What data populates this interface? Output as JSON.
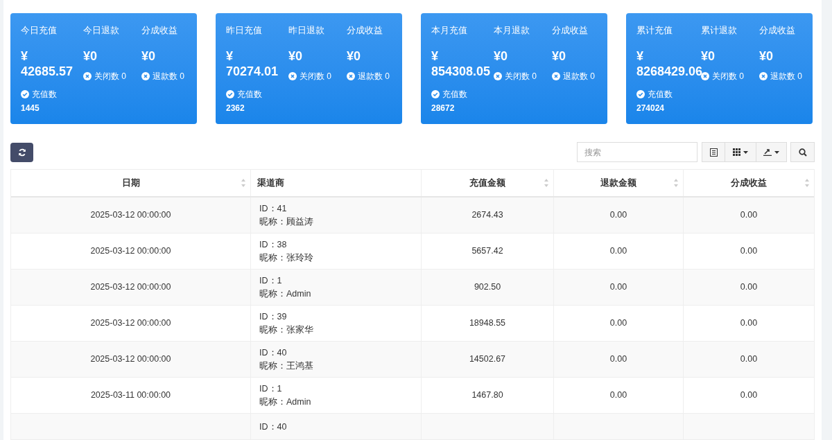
{
  "cards": [
    {
      "columns": [
        {
          "label": "今日充值",
          "value": "¥ 42685.57",
          "kind": "check",
          "stat_label": "充值数",
          "stat_value": "1445"
        },
        {
          "label": "今日退款",
          "value": "¥0",
          "kind": "cross",
          "stat_label": "关闭数 0"
        },
        {
          "label": "分成收益",
          "value": "¥0",
          "kind": "cross",
          "stat_label": "退款数 0"
        }
      ]
    },
    {
      "columns": [
        {
          "label": "昨日充值",
          "value": "¥ 70274.01",
          "kind": "check",
          "stat_label": "充值数",
          "stat_value": "2362"
        },
        {
          "label": "昨日退款",
          "value": "¥0",
          "kind": "cross",
          "stat_label": "关闭数 0"
        },
        {
          "label": "分成收益",
          "value": "¥0",
          "kind": "cross",
          "stat_label": "退款数 0"
        }
      ]
    },
    {
      "columns": [
        {
          "label": "本月充值",
          "value": "¥ 854308.05",
          "kind": "check",
          "stat_label": "充值数",
          "stat_value": "28672"
        },
        {
          "label": "本月退款",
          "value": "¥0",
          "kind": "cross",
          "stat_label": "关闭数 0"
        },
        {
          "label": "分成收益",
          "value": "¥0",
          "kind": "cross",
          "stat_label": "退款数 0"
        }
      ]
    },
    {
      "columns": [
        {
          "label": "累计充值",
          "value": "¥ 8268429.06",
          "kind": "check",
          "stat_label": "充值数",
          "stat_value": "274024"
        },
        {
          "label": "累计退款",
          "value": "¥0",
          "kind": "cross",
          "stat_label": "关闭数 0"
        },
        {
          "label": "分成收益",
          "value": "¥0",
          "kind": "cross",
          "stat_label": "退款数 0"
        }
      ]
    }
  ],
  "search": {
    "placeholder": "搜索"
  },
  "table": {
    "columns": [
      {
        "label": "日期",
        "sortable": true
      },
      {
        "label": "渠道商",
        "sortable": false
      },
      {
        "label": "充值金额",
        "sortable": true
      },
      {
        "label": "退款金额",
        "sortable": true
      },
      {
        "label": "分成收益",
        "sortable": true
      }
    ],
    "rows": [
      {
        "date": "2025-03-12 00:00:00",
        "channel_id": "ID：41",
        "channel_name": "昵称：顾益涛",
        "recharge": "2674.43",
        "refund": "0.00",
        "share": "0.00"
      },
      {
        "date": "2025-03-12 00:00:00",
        "channel_id": "ID：38",
        "channel_name": "昵称：张玲玲",
        "recharge": "5657.42",
        "refund": "0.00",
        "share": "0.00"
      },
      {
        "date": "2025-03-12 00:00:00",
        "channel_id": "ID：1",
        "channel_name": "昵称：Admin",
        "recharge": "902.50",
        "refund": "0.00",
        "share": "0.00"
      },
      {
        "date": "2025-03-12 00:00:00",
        "channel_id": "ID：39",
        "channel_name": "昵称：张家华",
        "recharge": "18948.55",
        "refund": "0.00",
        "share": "0.00"
      },
      {
        "date": "2025-03-12 00:00:00",
        "channel_id": "ID：40",
        "channel_name": "昵称：王鸿基",
        "recharge": "14502.67",
        "refund": "0.00",
        "share": "0.00"
      },
      {
        "date": "2025-03-11 00:00:00",
        "channel_id": "ID：1",
        "channel_name": "昵称：Admin",
        "recharge": "1467.80",
        "refund": "0.00",
        "share": "0.00"
      },
      {
        "channel_id": "ID：40"
      }
    ]
  }
}
